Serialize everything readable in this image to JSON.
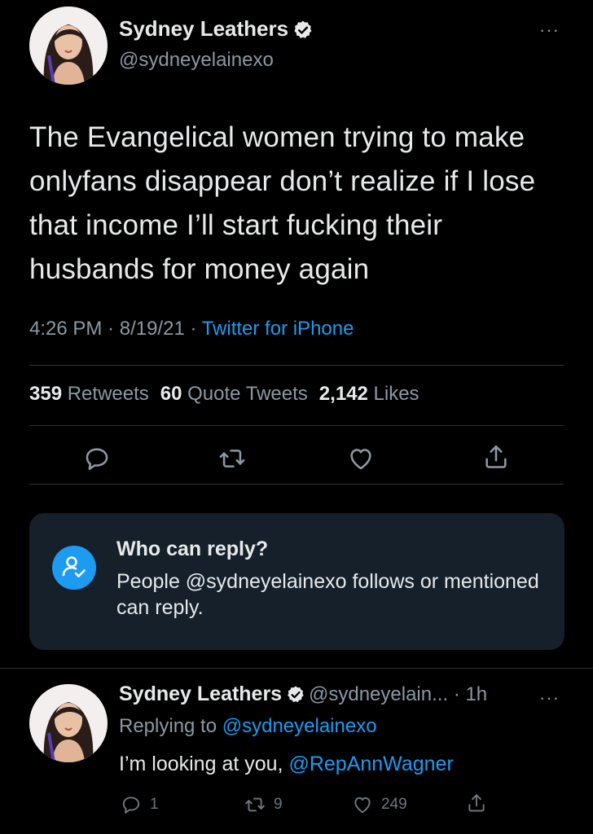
{
  "tweet": {
    "author": {
      "display_name": "Sydney Leathers",
      "handle": "@sydneyelainexo",
      "verified_icon": "verified-badge-icon",
      "avatar_icon": "avatar"
    },
    "more_icon": "···",
    "text": "The Evangelical women trying to make onlyfans disappear don’t realize if I lose that income I’ll start fucking their husbands for money again",
    "meta": {
      "time": "4:26 PM",
      "sep1": " · ",
      "date": "8/19/21",
      "sep2": " · ",
      "source": "Twitter for iPhone"
    },
    "stats": {
      "retweets_count": "359",
      "retweets_label": "Retweets",
      "quotes_count": "60",
      "quotes_label": "Quote Tweets",
      "likes_count": "2,142",
      "likes_label": "Likes"
    },
    "actions": [
      "reply-icon",
      "retweet-icon",
      "like-icon",
      "share-icon"
    ]
  },
  "who_can_reply": {
    "title": "Who can reply?",
    "body": "People @sydneyelainexo follows or mentioned can reply.",
    "icon": "people-check-icon"
  },
  "reply": {
    "display_name": "Sydney Leathers",
    "handle_time": "@sydneyelain... · 1h",
    "more_icon": "···",
    "replying_prefix": "Replying to",
    "replying_handle": "@sydneyelainexo",
    "text_prefix": "I’m looking at you,",
    "text_mention": "@RepAnnWagner",
    "counts": {
      "replies": "1",
      "retweets": "9",
      "likes": "249"
    }
  },
  "colors": {
    "background": "#000000",
    "text": "#e7e9ea",
    "secondary": "#8b98a5",
    "link": "#1d9bf0",
    "card": "#15202b",
    "divider": "#2f3336"
  }
}
